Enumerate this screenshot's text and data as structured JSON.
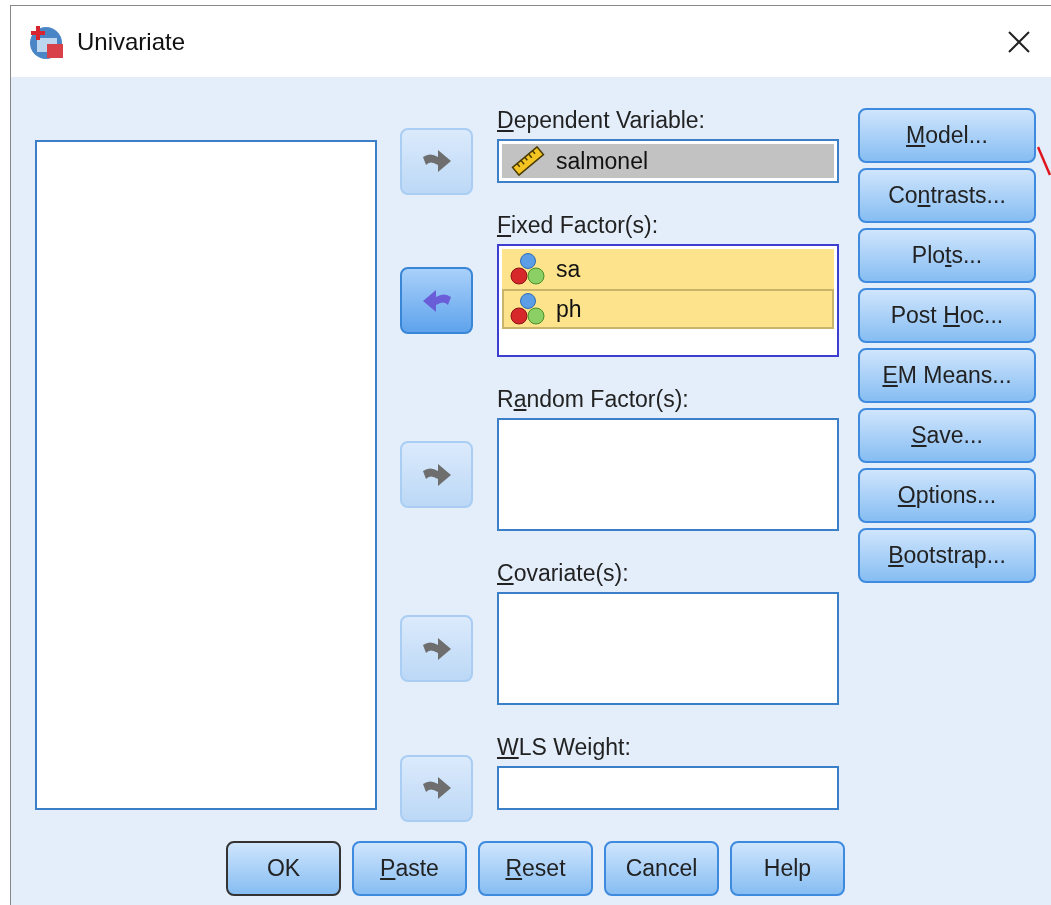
{
  "window": {
    "title": "Univariate"
  },
  "sections": [
    {
      "label": {
        "key": "D",
        "after": "ependent Variable:"
      },
      "arrow": {
        "kind": "right",
        "disabled": true
      },
      "kind": "single",
      "focused": false,
      "items": [
        {
          "value": "salmonel",
          "kind": "scale",
          "selected": true,
          "focused": false
        }
      ]
    },
    {
      "label": {
        "key": "F",
        "after": "ixed Factor(s):"
      },
      "arrow": {
        "kind": "left",
        "disabled": false
      },
      "kind": "list",
      "focused": true,
      "items": [
        {
          "value": "sa",
          "kind": "nominal",
          "selected": true,
          "focused": false
        },
        {
          "value": "ph",
          "kind": "nominal",
          "selected": true,
          "focused": true
        }
      ]
    },
    {
      "label": {
        "before": "R",
        "key": "a",
        "after": "ndom Factor(s):"
      },
      "arrow": {
        "kind": "right",
        "disabled": true
      },
      "kind": "list",
      "focused": false
    },
    {
      "label": {
        "key": "C",
        "after": "ovariate(s):"
      },
      "arrow": {
        "kind": "right",
        "disabled": true
      },
      "kind": "list",
      "focused": false
    },
    {
      "label": {
        "key": "W",
        "after": "LS Weight:"
      },
      "arrow": {
        "kind": "right",
        "disabled": true
      },
      "kind": "single",
      "focused": false
    }
  ],
  "side_buttons": [
    {
      "label": {
        "key": "M",
        "after": "odel..."
      }
    },
    {
      "label": {
        "before": "Co",
        "key": "n",
        "after": "trasts..."
      }
    },
    {
      "label": {
        "before": "Plo",
        "key": "t",
        "after": "s..."
      }
    },
    {
      "label": {
        "before": "Post ",
        "key": "H",
        "after": "oc..."
      }
    },
    {
      "label": {
        "key": "E",
        "after": "M Means..."
      }
    },
    {
      "label": {
        "key": "S",
        "after": "ave..."
      }
    },
    {
      "label": {
        "key": "O",
        "after": "ptions..."
      }
    },
    {
      "label": {
        "key": "B",
        "after": "ootstrap..."
      }
    }
  ],
  "bottom_buttons": [
    {
      "label": {
        "before": "OK"
      },
      "default": true
    },
    {
      "label": {
        "key": "P",
        "after": "aste"
      },
      "default": false
    },
    {
      "label": {
        "key": "R",
        "after": "eset"
      },
      "default": false
    },
    {
      "label": {
        "before": "Cancel"
      },
      "default": false
    },
    {
      "label": {
        "before": "Help"
      },
      "default": false
    }
  ]
}
